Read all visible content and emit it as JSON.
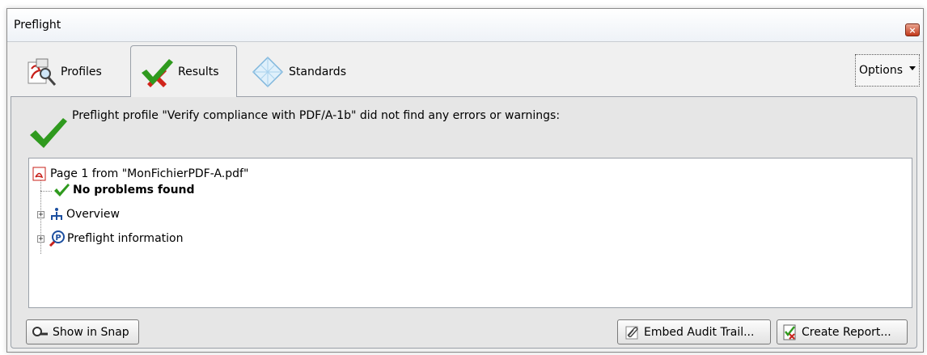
{
  "window": {
    "title": "Preflight"
  },
  "tabs": [
    {
      "label": "Profiles",
      "icon": "profiles-icon"
    },
    {
      "label": "Results",
      "icon": "results-icon",
      "active": true
    },
    {
      "label": "Standards",
      "icon": "standards-icon"
    }
  ],
  "options": {
    "label": "Options"
  },
  "result_message": "Preflight profile \"Verify compliance with PDF/A-1b\" did not find any errors or warnings:",
  "tree": {
    "root": "Page 1 from \"MonFichierPDF-A.pdf\"",
    "status": "No problems found",
    "overview": "Overview",
    "info": "Preflight information"
  },
  "buttons": {
    "show_in_snap": "Show in Snap",
    "embed_audit": "Embed Audit Trail...",
    "create_report": "Create Report..."
  },
  "colors": {
    "check_green": "#2f9a1e",
    "pdf_red": "#c8201a",
    "close_red": "#c2391b"
  }
}
